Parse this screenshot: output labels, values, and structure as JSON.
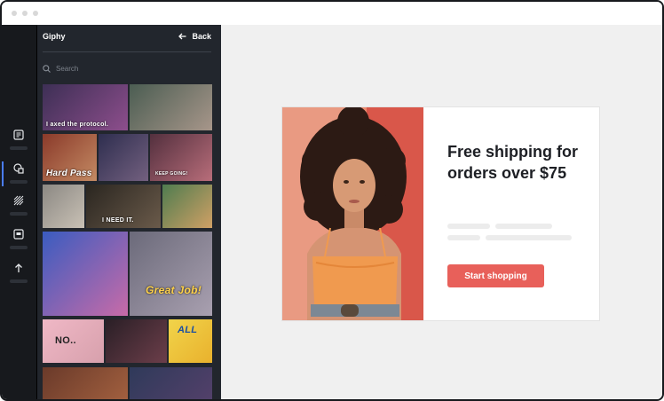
{
  "panel": {
    "title": "Giphy",
    "back_label": "Back",
    "search_placeholder": "Search"
  },
  "rail": {
    "items": [
      "text-icon",
      "shapes-icon",
      "pattern-icon",
      "media-icon",
      "upload-icon"
    ],
    "active_index": 1
  },
  "gifs": [
    {
      "caption": "I axed the protocol.",
      "colors": [
        "#3d2f55",
        "#8d4e8c"
      ]
    },
    {
      "caption": "",
      "colors": [
        "#4b5d52",
        "#a7968a"
      ]
    },
    {
      "caption": "Hard Pass",
      "colors": [
        "#8a3a2a",
        "#c48a63"
      ]
    },
    {
      "caption": "",
      "colors": [
        "#2e2e4f",
        "#73607f"
      ]
    },
    {
      "caption": "KEEP GOING!",
      "colors": [
        "#53303e",
        "#b86d7a"
      ]
    },
    {
      "caption": "",
      "colors": [
        "#8b8883",
        "#c9c1b5"
      ]
    },
    {
      "caption": "I NEED IT.",
      "colors": [
        "#2a2620",
        "#6a5a4a"
      ]
    },
    {
      "caption": "",
      "colors": [
        "#4f7c4f",
        "#d0a065"
      ]
    },
    {
      "caption": "",
      "colors": [
        "#3a5cc0",
        "#c86ba8"
      ]
    },
    {
      "caption": "Great Job!",
      "colors": [
        "#6b6a7a",
        "#a9a0b0"
      ]
    },
    {
      "caption": "NO..",
      "colors": [
        "#f0b8c6",
        "#d7a0ac"
      ]
    },
    {
      "caption": "",
      "colors": [
        "#2a1f26",
        "#6c3e4a"
      ]
    },
    {
      "caption": "ALL",
      "colors": [
        "#f1d44a",
        "#e9b12d"
      ]
    },
    {
      "caption": "",
      "colors": [
        "#6a3a2a",
        "#a2603f"
      ]
    },
    {
      "caption": "",
      "colors": [
        "#2f3a5a",
        "#53406a"
      ]
    }
  ],
  "card": {
    "headline": "Free shipping for orders over $75",
    "cta_label": "Start shopping"
  },
  "colors": {
    "accent": "#e8605a",
    "sidebar_bg": "#17191d",
    "panel_bg": "#22262d",
    "active_indicator": "#4a7dff"
  }
}
